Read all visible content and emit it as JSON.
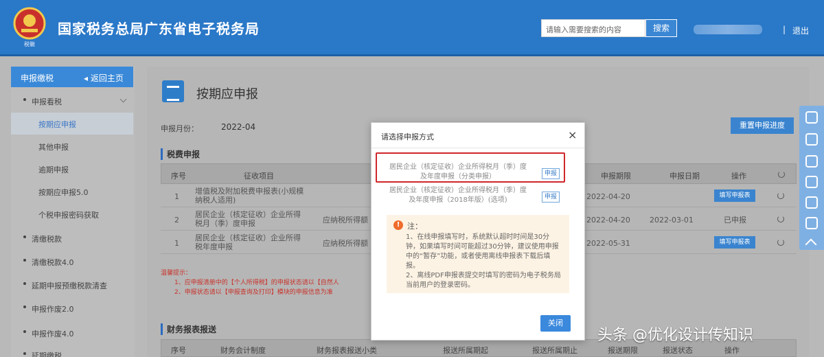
{
  "header": {
    "logo_text": "税徽",
    "title": "国家税务总局广东省电子税务局",
    "search_placeholder": "请输入需要搜索的内容",
    "search_button": "搜索",
    "separator": "|",
    "logout": "退出"
  },
  "sidebar": {
    "header_title": "申报缴税",
    "back_label": "返回主页",
    "items": [
      {
        "label": "申报看税",
        "type": "parent"
      },
      {
        "label": "按期应申报",
        "type": "sub"
      },
      {
        "label": "其他申报",
        "type": "sub"
      },
      {
        "label": "逾期申报",
        "type": "sub"
      },
      {
        "label": "按期应申报5.0",
        "type": "sub"
      },
      {
        "label": "个税申报密码获取",
        "type": "sub"
      },
      {
        "label": "清缴税款",
        "type": "parent"
      },
      {
        "label": "清缴税款4.0",
        "type": "parent"
      },
      {
        "label": "延期申报预缴税款清查",
        "type": "parent"
      },
      {
        "label": "申报作废2.0",
        "type": "parent"
      },
      {
        "label": "申报作废4.0",
        "type": "parent"
      },
      {
        "label": "延期缴税",
        "type": "parent"
      }
    ]
  },
  "main": {
    "page_title": "按期应申报",
    "period_label": "申报月份：",
    "period_value": "2022-04",
    "top_button": "重置申报进度",
    "section1_title": "税费申报",
    "table1": {
      "headers": [
        "序号",
        "征收项目",
        "申报期限",
        "申报日期",
        "操作"
      ],
      "rows": [
        {
          "no": "1",
          "item": "增值税及附加税费申报表(小规模纳税人适用)",
          "extra": "",
          "deadline": "2022-04-20",
          "date": "",
          "op": "填写申报表"
        },
        {
          "no": "2",
          "item": "居民企业（核定征收）企业所得税月（季）度申报",
          "extra": "应纳税所得额",
          "deadline": "2022-04-20",
          "date": "2022-03-01",
          "op": "已申报"
        },
        {
          "no": "1",
          "item": "居民企业（核定征收）企业所得税年度申报",
          "extra": "应纳税所得额",
          "deadline": "2022-05-31",
          "date": "",
          "op": "填写申报表"
        }
      ]
    },
    "red_tip": {
      "title": "温馨提示：",
      "line1": "1、应申报清册中的【个人所得税】的申报状态请以【自然人",
      "line2": "2、申报状态请以【申报查询及打印】模块的申报信息为准"
    },
    "section2_title": "财务报表报送",
    "table2_headers": [
      "序号",
      "财务会计制度",
      "财务报表报送小类",
      "报送所属期起",
      "报送所属期止",
      "报送期限",
      "报送状态",
      "操作"
    ]
  },
  "modal": {
    "title": "请选择申报方式",
    "close": "×",
    "options": [
      {
        "text": "居民企业（核定征收）企业所得税月（季）度及年度申报（分类申报）",
        "button": "申报"
      },
      {
        "text": "居民企业（核定征收）企业所得税月（季）度及年度申报（2018年版）(选项)",
        "button": "申报"
      }
    ],
    "note_title": "注：",
    "note_line1": "1、在线申报填写时，系统默认超时时间是30分钟，如果填写时间可能超过30分钟，建议使用申报中的“暂存”功能，或者使用离线申报表下载后填报。",
    "note_line2": "2、离线PDF申报表提交时填写的密码为电子税务局当前用户的登录密码。",
    "close_button": "关闭"
  },
  "watermark": "头条 @优化设计传知识",
  "colors": {
    "header_blue": "#2a78c8",
    "accent_blue": "#3a89dd",
    "highlight_red": "#d0262a",
    "note_orange": "#ef6c2c"
  }
}
